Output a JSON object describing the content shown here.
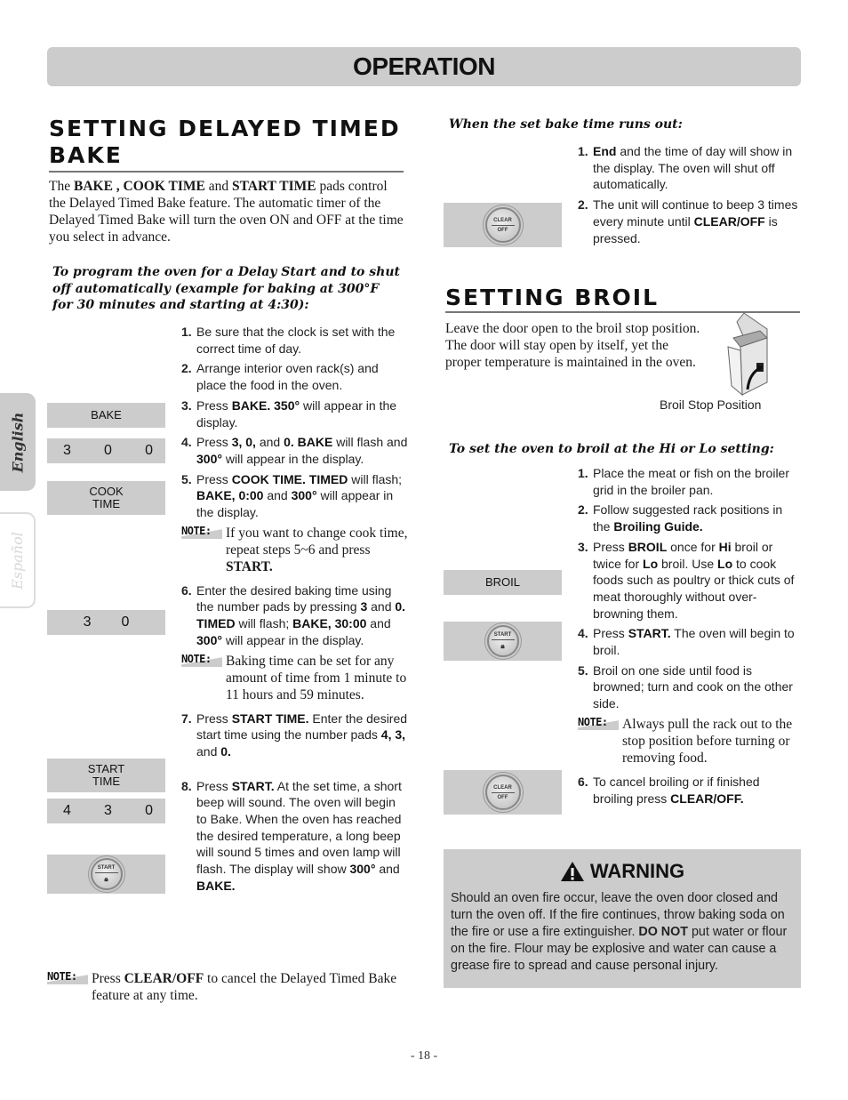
{
  "header": {
    "title": "OPERATION"
  },
  "language_tabs": [
    {
      "label": "English",
      "active": true
    },
    {
      "label": "Español",
      "active": false
    }
  ],
  "delayed_bake": {
    "title_line1": "SETTING DELAYED TIMED",
    "title_line2": "BAKE",
    "intro": {
      "p1": "The ",
      "b1": "BAKE , COOK TIME",
      "p2": " and ",
      "b2": "START TIME",
      "p3": " pads control the Delayed Timed Bake feature. The automatic timer of the Delayed Timed Bake will turn the oven ON and OFF at the time you select in advance."
    },
    "subheading": "To program the oven for a Delay Start and to shut off automatically (example for baking at 300°F for 30 minutes and starting at 4:30):",
    "pads": {
      "bake": "BAKE",
      "digits_300": [
        "3",
        "0",
        "0"
      ],
      "cook_time": [
        "COOK",
        "TIME"
      ],
      "digits_30": [
        "3",
        "0"
      ],
      "start_time": [
        "START",
        "TIME"
      ],
      "digits_430": [
        "4",
        "3",
        "0"
      ],
      "start_button": "START"
    },
    "steps": [
      {
        "num": "1.",
        "parts": [
          [
            "t",
            "Be sure that the clock is set with the correct time of day."
          ]
        ]
      },
      {
        "num": "2.",
        "parts": [
          [
            "t",
            "Arrange interior oven rack(s) and place the food in the oven."
          ]
        ]
      },
      {
        "num": "3.",
        "parts": [
          [
            "t",
            "Press "
          ],
          [
            "b",
            "BAKE. 350°"
          ],
          [
            "t",
            " will appear in the display."
          ]
        ]
      },
      {
        "num": "4.",
        "parts": [
          [
            "t",
            "Press "
          ],
          [
            "b",
            "3, 0,"
          ],
          [
            "t",
            " and "
          ],
          [
            "b",
            "0. BAKE"
          ],
          [
            "t",
            " will flash and "
          ],
          [
            "b",
            "300°"
          ],
          [
            "t",
            " will appear in the display."
          ]
        ]
      },
      {
        "num": "5.",
        "parts": [
          [
            "t",
            "Press "
          ],
          [
            "b",
            "COOK TIME. TIMED"
          ],
          [
            "t",
            " will flash; "
          ],
          [
            "b",
            "BAKE, 0:00"
          ],
          [
            "t",
            " and "
          ],
          [
            "b",
            "300°"
          ],
          [
            "t",
            " will appear in the display."
          ]
        ]
      },
      {
        "num": "6.",
        "parts": [
          [
            "t",
            "Enter the desired baking time using the number pads by pressing "
          ],
          [
            "b",
            "3"
          ],
          [
            "t",
            " and "
          ],
          [
            "b",
            "0. TIMED"
          ],
          [
            "t",
            " will flash; "
          ],
          [
            "b",
            "BAKE, 30:00"
          ],
          [
            "t",
            " and "
          ],
          [
            "b",
            "300°"
          ],
          [
            "t",
            " will appear in the display."
          ]
        ]
      },
      {
        "num": "7.",
        "parts": [
          [
            "t",
            "Press "
          ],
          [
            "b",
            "START TIME."
          ],
          [
            "t",
            " Enter the desired start time using the number pads "
          ],
          [
            "b",
            "4, 3,"
          ],
          [
            "t",
            " and "
          ],
          [
            "b",
            "0."
          ]
        ]
      },
      {
        "num": "8.",
        "parts": [
          [
            "t",
            "Press "
          ],
          [
            "b",
            "START."
          ],
          [
            "t",
            " At the set time, a short beep will sound. The oven will begin to Bake. When the oven has reached the desired temperature, a long beep will sound 5 times and oven lamp will flash. The display will show "
          ],
          [
            "b",
            "300°"
          ],
          [
            "t",
            " and "
          ],
          [
            "b",
            "BAKE."
          ]
        ]
      }
    ],
    "note_label": "NOTE:",
    "note_after_5": {
      "p1": "If you want to change cook time, repeat steps 5~6 and press ",
      "b1": "START."
    },
    "note_after_6": "Baking time can be set for any amount of time from 1 minute to 11 hours and 59 minutes.",
    "final_note": {
      "p1": "Press ",
      "b1": "CLEAR/OFF",
      "p2": " to cancel the Delayed Timed Bake feature at any time."
    }
  },
  "runs_out": {
    "heading": "When the set bake time runs out:",
    "clear_button": [
      "CLEAR",
      "OFF"
    ],
    "steps": [
      {
        "num": "1.",
        "parts": [
          [
            "b",
            "End"
          ],
          [
            "t",
            " and the time of day will show in the display. The oven will shut off automatically."
          ]
        ]
      },
      {
        "num": "2.",
        "parts": [
          [
            "t",
            "The unit will continue to beep 3 times every minute until "
          ],
          [
            "b",
            "CLEAR/OFF"
          ],
          [
            "t",
            " is pressed."
          ]
        ]
      }
    ]
  },
  "broil": {
    "title": "SETTING BROIL",
    "intro": "Leave the door open to the broil stop position. The door will stay open by itself, yet the proper temperature is maintained in the oven.",
    "image_caption": "Broil Stop Position",
    "subheading": "To set the oven to broil at the Hi or Lo setting:",
    "pads": {
      "broil": "BROIL",
      "start_button": "START",
      "clear_button": [
        "CLEAR",
        "OFF"
      ]
    },
    "steps": [
      {
        "num": "1.",
        "parts": [
          [
            "t",
            "Place the meat or fish on the broiler grid in the broiler pan."
          ]
        ]
      },
      {
        "num": "2.",
        "parts": [
          [
            "t",
            "Follow suggested rack positions in the "
          ],
          [
            "b",
            "Broiling Guide."
          ]
        ]
      },
      {
        "num": "3.",
        "parts": [
          [
            "t",
            "Press "
          ],
          [
            "b",
            "BROIL"
          ],
          [
            "t",
            " once for "
          ],
          [
            "b",
            "Hi"
          ],
          [
            "t",
            " broil or twice for "
          ],
          [
            "b",
            "Lo"
          ],
          [
            "t",
            " broil. Use "
          ],
          [
            "b",
            "Lo"
          ],
          [
            "t",
            " to cook foods such as poultry or thick cuts of meat thoroughly without over-browning them."
          ]
        ]
      },
      {
        "num": "4.",
        "parts": [
          [
            "t",
            "Press "
          ],
          [
            "b",
            "START."
          ],
          [
            "t",
            " The oven will begin to broil."
          ]
        ]
      },
      {
        "num": "5.",
        "parts": [
          [
            "t",
            "Broil on one side until food is browned; turn and cook on the other side."
          ]
        ]
      },
      {
        "num": "6.",
        "parts": [
          [
            "t",
            "To cancel broiling or if finished broiling press "
          ],
          [
            "b",
            "CLEAR/OFF."
          ]
        ]
      }
    ],
    "note_after_5": "Always pull the rack out to the stop position before turning or removing food."
  },
  "warning": {
    "title": "WARNING",
    "p1": "Should an oven fire occur, leave the oven door closed and turn the oven off. If the fire continues, throw baking soda on the fire or use a fire extinguisher. ",
    "b1": "DO NOT",
    "p2": " put water or flour on the fire. Flour may be explosive and water can cause a grease fire to spread and cause personal injury."
  },
  "page_number": "- 18 -"
}
